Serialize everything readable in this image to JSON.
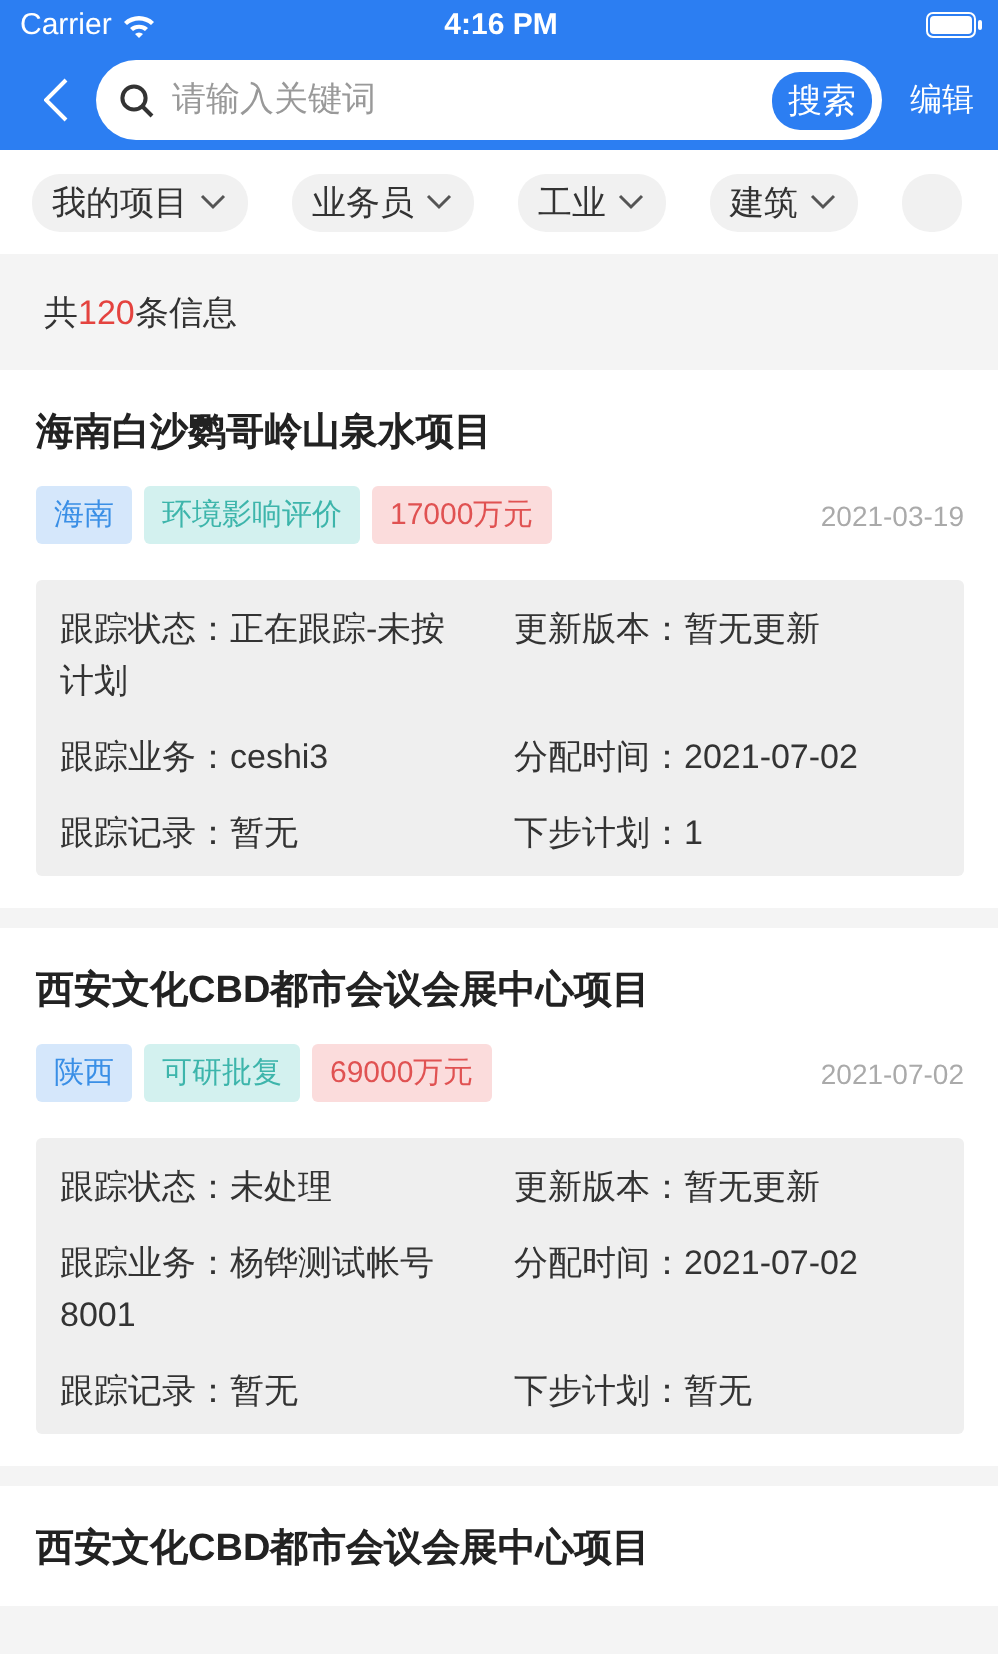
{
  "status_bar": {
    "carrier": "Carrier",
    "time": "4:16 PM"
  },
  "nav_bar": {
    "search": {
      "placeholder": "请输入关键词",
      "button": "搜索"
    },
    "edit": "编辑"
  },
  "filters": [
    {
      "label": "我的项目"
    },
    {
      "label": "业务员"
    },
    {
      "label": "工业"
    },
    {
      "label": "建筑"
    }
  ],
  "count": {
    "prefix": "共",
    "number": "120",
    "suffix": "条信息"
  },
  "projects": [
    {
      "title": "海南白沙鹦哥岭山泉水项目",
      "tags": [
        {
          "kind": "region",
          "label": "海南"
        },
        {
          "kind": "type",
          "label": "环境影响评价"
        },
        {
          "kind": "amount",
          "label": "17000万元"
        }
      ],
      "date": "2021-03-19",
      "fields": [
        "跟踪状态：正在跟踪-未按计划",
        "更新版本：暂无更新",
        "跟踪业务：ceshi3",
        "分配时间：2021-07-02",
        "跟踪记录：暂无",
        "下步计划：1"
      ]
    },
    {
      "title": "西安文化CBD都市会议会展中心项目",
      "tags": [
        {
          "kind": "region",
          "label": "陕西"
        },
        {
          "kind": "type",
          "label": "可研批复"
        },
        {
          "kind": "amount",
          "label": "69000万元"
        }
      ],
      "date": "2021-07-02",
      "fields": [
        "跟踪状态：未处理",
        "更新版本：暂无更新",
        "跟踪业务：杨铧测试帐号8001",
        "分配时间：2021-07-02",
        "跟踪记录：暂无",
        "下步计划：暂无"
      ]
    },
    {
      "title": "西安文化CBD都市会议会展中心项目"
    }
  ]
}
